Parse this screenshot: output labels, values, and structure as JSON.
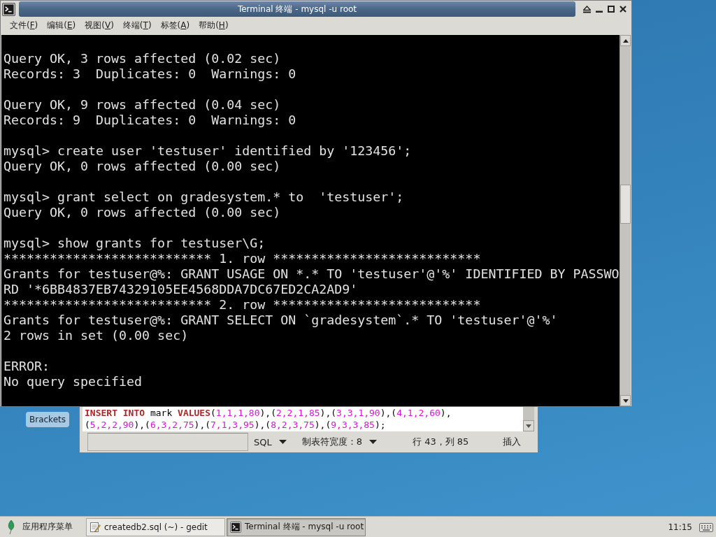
{
  "desktop": {
    "icon_label": "Brackets"
  },
  "terminal": {
    "title": "Terminal 终端 - mysql -u root",
    "menu": [
      {
        "before": "文件(",
        "key": "F",
        "after": ")"
      },
      {
        "before": "编辑(",
        "key": "E",
        "after": ")"
      },
      {
        "before": "视图(",
        "key": "V",
        "after": ")"
      },
      {
        "before": "终端(",
        "key": "T",
        "after": ")"
      },
      {
        "before": "标签(",
        "key": "A",
        "after": ")"
      },
      {
        "before": "帮助(",
        "key": "H",
        "after": ")"
      }
    ],
    "output": [
      [
        "Query OK, 3 rows affected (0.02 sec)",
        "Records: 3  Duplicates: 0  Warnings: 0"
      ],
      [
        "Query OK, 9 rows affected (0.04 sec)",
        "Records: 9  Duplicates: 0  Warnings: 0"
      ],
      [
        "mysql> create user 'testuser' identified by '123456';",
        "Query OK, 0 rows affected (0.00 sec)"
      ],
      [
        "mysql> grant select on gradesystem.* to  'testuser';",
        "Query OK, 0 rows affected (0.00 sec)"
      ],
      [
        "mysql> show grants for testuser\\G;",
        "*************************** 1. row ***************************",
        "Grants for testuser@%: GRANT USAGE ON *.* TO 'testuser'@'%' IDENTIFIED BY PASSWO",
        "RD '*6BB4837EB74329105EE4568DDA7DC67ED2CA2AD9'",
        "*************************** 2. row ***************************",
        "Grants for testuser@%: GRANT SELECT ON `gradesystem`.* TO 'testuser'@'%'",
        "2 rows in set (0.00 sec)"
      ],
      [
        "ERROR:",
        "No query specified"
      ]
    ]
  },
  "editor": {
    "code_lines": [
      [
        {
          "text": "INSERT INTO",
          "kind": "keyword"
        },
        {
          "text": " mark ",
          "kind": "plain"
        },
        {
          "text": "VALUES",
          "kind": "keyword"
        },
        {
          "text": "(",
          "kind": "plain"
        },
        {
          "text": "1,1,1,80",
          "kind": "number"
        },
        {
          "text": "),(",
          "kind": "plain"
        },
        {
          "text": "2,2,1,85",
          "kind": "number"
        },
        {
          "text": "),(",
          "kind": "plain"
        },
        {
          "text": "3,3,1,90",
          "kind": "number"
        },
        {
          "text": "),(",
          "kind": "plain"
        },
        {
          "text": "4,1,2,60",
          "kind": "number"
        },
        {
          "text": "),",
          "kind": "plain"
        }
      ],
      [
        {
          "text": "(",
          "kind": "plain"
        },
        {
          "text": "5,2,2,90",
          "kind": "number"
        },
        {
          "text": "),(",
          "kind": "plain"
        },
        {
          "text": "6,3,2,75",
          "kind": "number"
        },
        {
          "text": "),(",
          "kind": "plain"
        },
        {
          "text": "7,1,3,95",
          "kind": "number"
        },
        {
          "text": "),(",
          "kind": "plain"
        },
        {
          "text": "8,2,3,75",
          "kind": "number"
        },
        {
          "text": "),(",
          "kind": "plain"
        },
        {
          "text": "9,3,3,85",
          "kind": "number"
        },
        {
          "text": ");",
          "kind": "plain"
        }
      ]
    ],
    "status_bar": {
      "language": "SQL",
      "tab_width": "制表符宽度：8",
      "cursor_position": "行 43，列 85",
      "mode": "插入"
    }
  },
  "taskbar": {
    "app_menu": "应用程序菜单",
    "tasks": [
      {
        "kind": "editor",
        "label": "createdb2.sql (~) - gedit",
        "selected": false
      },
      {
        "kind": "terminal",
        "label": "Terminal 终端 - mysql -u root",
        "selected": true
      }
    ],
    "clock": "11:15"
  }
}
